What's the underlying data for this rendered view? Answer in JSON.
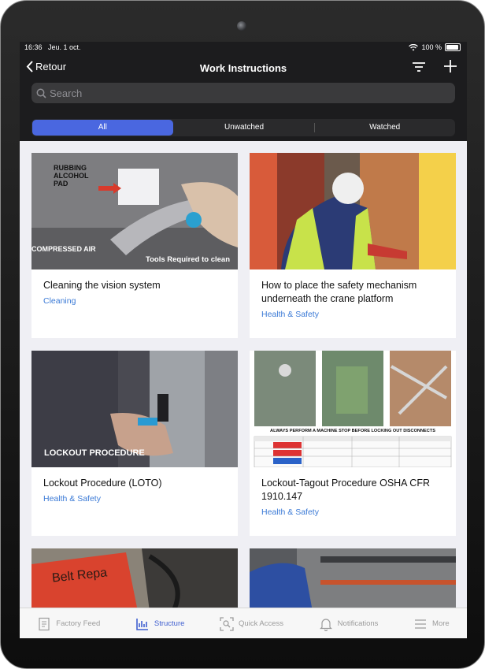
{
  "status_bar": {
    "time": "16:36",
    "date": "Jeu. 1 oct.",
    "battery": "100 %"
  },
  "nav": {
    "back_label": "Retour",
    "title": "Work Instructions"
  },
  "search": {
    "placeholder": "Search"
  },
  "segments": [
    "All",
    "Unwatched",
    "Watched"
  ],
  "cards": [
    {
      "title": "Cleaning the vision system",
      "category": "Cleaning",
      "overlay_top": "RUBBING\nALCOHOL\nPAD",
      "overlay_left": "COMPRESSED AIR",
      "overlay_right": "Tools Required to clean"
    },
    {
      "title": "How to place the safety mechanism underneath the crane platform",
      "category": "Health & Safety"
    },
    {
      "title": "Lockout Procedure (LOTO)",
      "category": "Health & Safety",
      "overlay": "LOCKOUT PROCEDURE"
    },
    {
      "title": "Lockout-Tagout Procedure OSHA CFR 1910.147",
      "category": "Health & Safety",
      "banner": "ALWAYS PERFORM A MACHINE STOP BEFORE LOCKING OUT DISCONNECTS"
    },
    {
      "title": "",
      "category": "",
      "overlay": "Belt Repa"
    },
    {
      "title": "",
      "category": ""
    }
  ],
  "tabbar": [
    {
      "label": "Factory Feed",
      "icon": "feed-icon"
    },
    {
      "label": "Structure",
      "icon": "structure-icon"
    },
    {
      "label": "Quick Access",
      "icon": "scan-icon"
    },
    {
      "label": "Notifications",
      "icon": "bell-icon"
    },
    {
      "label": "More",
      "icon": "menu-icon"
    }
  ],
  "colors": {
    "accent": "#4a67e0",
    "category": "#3b7ad6",
    "tab_active": "#3f5fd0",
    "dark_bg": "#1c1c1e"
  }
}
